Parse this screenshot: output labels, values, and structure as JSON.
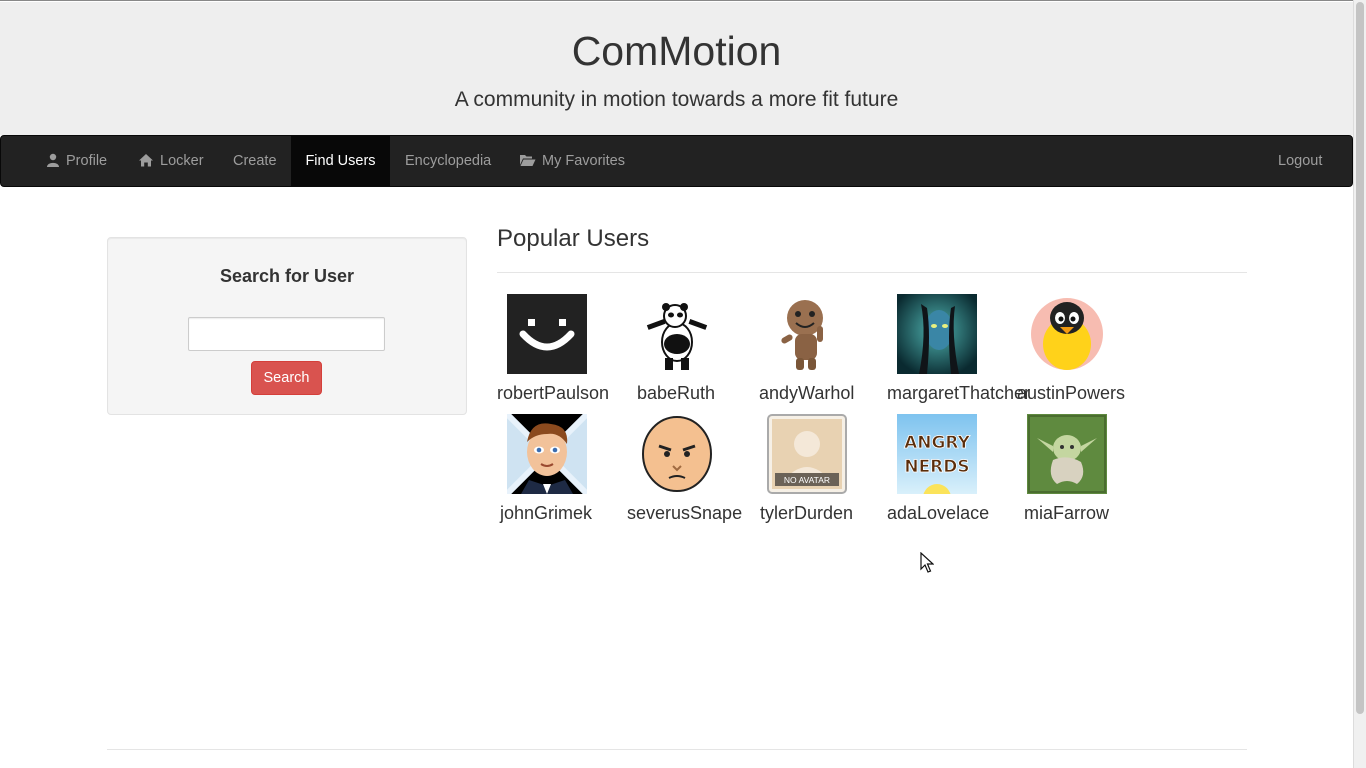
{
  "header": {
    "title": "ComMotion",
    "tagline": "A community in motion towards a more fit future"
  },
  "nav": {
    "profile": "Profile",
    "locker": "Locker",
    "create": "Create",
    "find_users": "Find Users",
    "encyclopedia": "Encyclopedia",
    "my_favorites": "My Favorites",
    "logout": "Logout"
  },
  "search": {
    "heading": "Search for User",
    "input_value": "",
    "button_label": "Search"
  },
  "popular": {
    "title": "Popular Users",
    "users": [
      {
        "name": "robertPaulson",
        "avatar": "smiley-avatar"
      },
      {
        "name": "babeRuth",
        "avatar": "panda-avatar"
      },
      {
        "name": "andyWarhol",
        "avatar": "sackboy-avatar"
      },
      {
        "name": "margaretThatcher",
        "avatar": "avatar-movie-avatar"
      },
      {
        "name": "austinPowers",
        "avatar": "penguin-avatar"
      },
      {
        "name": "johnGrimek",
        "avatar": "cartoon-man-avatar"
      },
      {
        "name": "severusSnape",
        "avatar": "bald-cartoon-avatar"
      },
      {
        "name": "tylerDurden",
        "avatar": "no-avatar-placeholder",
        "avatar_text": "NO AVATAR"
      },
      {
        "name": "adaLovelace",
        "avatar": "angry-nerds-avatar",
        "avatar_text": "ANGRY NERDS"
      },
      {
        "name": "miaFarrow",
        "avatar": "yoda-avatar"
      }
    ]
  },
  "colors": {
    "header_bg": "#eeeeee",
    "navbar_bg": "#222222",
    "nav_active_bg": "#080808",
    "search_button": "#d9534f"
  }
}
